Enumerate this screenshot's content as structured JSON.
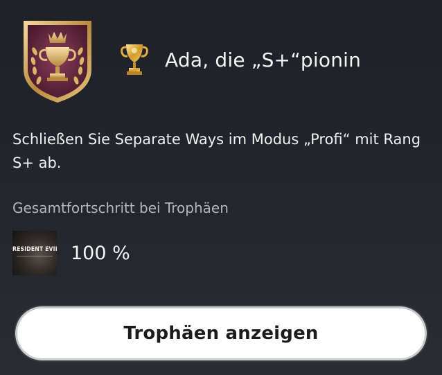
{
  "trophy": {
    "title": "Ada, die „S+“pionin",
    "grade": "gold",
    "description": "Schließen Sie Separate Ways im Modus „Profi“ mit Rang S+ ab.",
    "badge_icon": "trophy-crest-icon",
    "grade_icon": "gold-trophy-icon"
  },
  "progress": {
    "label": "Gesamtfortschritt bei Trophäen",
    "value_text": "100 %",
    "value_percent": 100,
    "game_thumbnail_text": "RESIDENT EVIL 4"
  },
  "actions": {
    "view_trophies_label": "Trophäen anzeigen"
  },
  "colors": {
    "background": "#23252c",
    "button_bg": "#ffffff",
    "button_text": "#1c1c1c",
    "secondary_text": "#b4b6bc",
    "gold": "#d7a53a",
    "badge_purple": "#5b2438"
  }
}
